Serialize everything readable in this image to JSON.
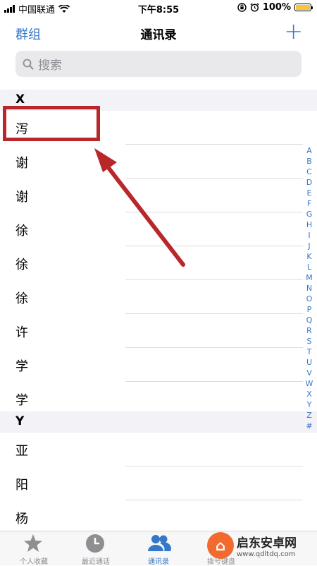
{
  "status_bar": {
    "carrier": "中国联通",
    "time": "下午8:55",
    "battery": "100%",
    "icons": [
      "signal-icon",
      "wifi-icon",
      "orientation-lock-icon",
      "alarm-icon",
      "battery-icon"
    ]
  },
  "nav": {
    "left": "群组",
    "title": "通讯录",
    "add": "+"
  },
  "search": {
    "placeholder": "搜索"
  },
  "sections": [
    {
      "letter": "X",
      "contacts": [
        "泻",
        "谢",
        "谢",
        "徐",
        "徐",
        "徐",
        "许",
        "学",
        "学"
      ]
    },
    {
      "letter": "Y",
      "contacts": [
        "亚",
        "阳",
        "杨"
      ]
    }
  ],
  "index_letters": [
    "A",
    "B",
    "C",
    "D",
    "E",
    "F",
    "G",
    "H",
    "I",
    "J",
    "K",
    "L",
    "M",
    "N",
    "O",
    "P",
    "Q",
    "R",
    "S",
    "T",
    "U",
    "V",
    "W",
    "X",
    "Y",
    "Z",
    "#"
  ],
  "tabs": [
    {
      "label": "个人收藏",
      "icon": "star-icon",
      "active": false
    },
    {
      "label": "最近通话",
      "icon": "clock-icon",
      "active": false
    },
    {
      "label": "通讯录",
      "icon": "contacts-icon",
      "active": true
    },
    {
      "label": "拨号键盘",
      "icon": "keypad-icon",
      "active": false
    }
  ],
  "watermark": {
    "title": "启东安卓网",
    "url": "www.qdltdq.com"
  },
  "colors": {
    "accent": "#3478c9",
    "annotation": "#b8272a"
  }
}
